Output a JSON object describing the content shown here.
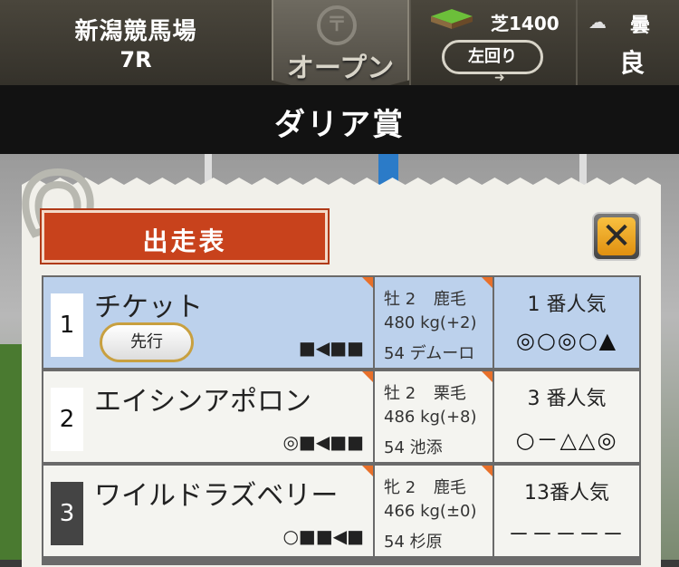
{
  "header": {
    "venue": "新潟競馬場",
    "race": "7R",
    "grade": "オープン",
    "surface": "芝1400",
    "direction": "左回り",
    "weather": "曇",
    "track_condition": "良"
  },
  "title": "ダリア賞",
  "panel": {
    "heading": "出走表",
    "close_icon": "close-icon"
  },
  "entries": [
    {
      "number": "1",
      "name": "チケット",
      "style": "先行",
      "recent": "■◀■■",
      "sex_age": "牡 2",
      "coat": "鹿毛",
      "weight": "480 kg(+2)",
      "jockey": "54 デムーロ",
      "popularity": "1 番人気",
      "marks": "◎○◎○▲",
      "selected": true
    },
    {
      "number": "2",
      "name": "エイシンアポロン",
      "style": "",
      "recent": "◎■◀■■",
      "sex_age": "牡 2",
      "coat": "栗毛",
      "weight": "486 kg(+8)",
      "jockey": "54 池添",
      "popularity": "3 番人気",
      "marks": "○－△△◎",
      "selected": false
    },
    {
      "number": "3",
      "name": "ワイルドラズベリー",
      "style": "",
      "recent": "○■■◀■",
      "sex_age": "牝 2",
      "coat": "鹿毛",
      "weight": "466 kg(±0)",
      "jockey": "54 杉原",
      "popularity": "13番人気",
      "marks": "－－－－－",
      "selected": false
    }
  ],
  "colors": {
    "heading_bg": "#c8421c",
    "selected_row": "#bcd1ec",
    "close_button": "#f0a020"
  }
}
